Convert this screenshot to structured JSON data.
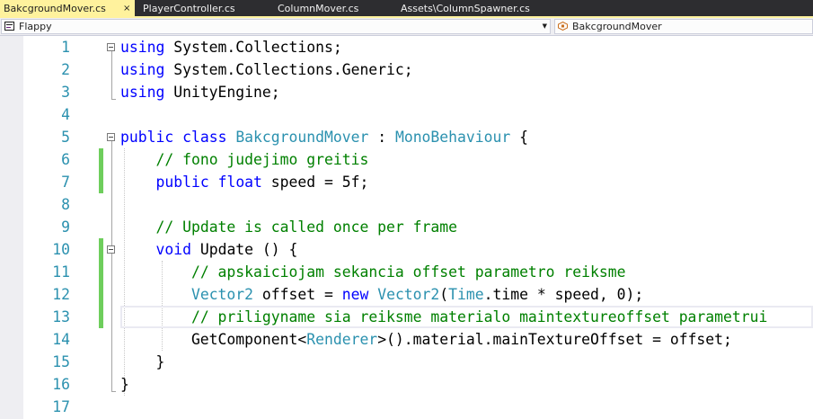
{
  "tabs": [
    {
      "label": "BakcgroundMover.cs",
      "active": true,
      "close_glyph": "×"
    },
    {
      "label": "PlayerController.cs",
      "active": false
    },
    {
      "label": "ColumnMover.cs",
      "active": false
    },
    {
      "label": "Assets\\ColumnSpawner.cs",
      "active": false
    }
  ],
  "navbar": {
    "project_combo": "Flappy",
    "class_combo": "BakcgroundMover",
    "dropdown_glyph": "▼"
  },
  "editor": {
    "line_numbers": [
      "1",
      "2",
      "3",
      "4",
      "5",
      "6",
      "7",
      "8",
      "9",
      "10",
      "11",
      "12",
      "13",
      "14",
      "15",
      "16",
      "17"
    ],
    "lines": [
      [
        {
          "t": "using",
          "c": "kw"
        },
        {
          "t": " System.Collections;",
          "c": "txt"
        }
      ],
      [
        {
          "t": "using",
          "c": "kw"
        },
        {
          "t": " System.Collections.Generic;",
          "c": "txt"
        }
      ],
      [
        {
          "t": "using",
          "c": "kw"
        },
        {
          "t": " UnityEngine;",
          "c": "txt"
        }
      ],
      [],
      [
        {
          "t": "public",
          "c": "kw"
        },
        {
          "t": " ",
          "c": "txt"
        },
        {
          "t": "class",
          "c": "kw"
        },
        {
          "t": " ",
          "c": "txt"
        },
        {
          "t": "BakcgroundMover",
          "c": "ty"
        },
        {
          "t": " : ",
          "c": "txt"
        },
        {
          "t": "MonoBehaviour",
          "c": "ty"
        },
        {
          "t": " {",
          "c": "txt"
        }
      ],
      [
        {
          "t": "    ",
          "c": "txt"
        },
        {
          "t": "// fono judejimo greitis",
          "c": "cm"
        }
      ],
      [
        {
          "t": "    ",
          "c": "txt"
        },
        {
          "t": "public",
          "c": "kw"
        },
        {
          "t": " ",
          "c": "txt"
        },
        {
          "t": "float",
          "c": "kw"
        },
        {
          "t": " speed = 5f;",
          "c": "txt"
        }
      ],
      [],
      [
        {
          "t": "    ",
          "c": "txt"
        },
        {
          "t": "// Update is called once per frame",
          "c": "cm"
        }
      ],
      [
        {
          "t": "    ",
          "c": "txt"
        },
        {
          "t": "void",
          "c": "kw"
        },
        {
          "t": " Update () {",
          "c": "txt"
        }
      ],
      [
        {
          "t": "        ",
          "c": "txt"
        },
        {
          "t": "// apskaiciojam sekancia offset parametro reiksme",
          "c": "cm"
        }
      ],
      [
        {
          "t": "        ",
          "c": "txt"
        },
        {
          "t": "Vector2",
          "c": "ty"
        },
        {
          "t": " offset = ",
          "c": "txt"
        },
        {
          "t": "new",
          "c": "kw"
        },
        {
          "t": " ",
          "c": "txt"
        },
        {
          "t": "Vector2",
          "c": "ty"
        },
        {
          "t": "(",
          "c": "txt"
        },
        {
          "t": "Time",
          "c": "ty"
        },
        {
          "t": ".time * speed, 0);",
          "c": "txt"
        }
      ],
      [
        {
          "t": "        ",
          "c": "txt"
        },
        {
          "t": "// priligyname sia reiksme materialo maintextureoffset parametrui",
          "c": "cm"
        }
      ],
      [
        {
          "t": "        GetComponent<",
          "c": "txt"
        },
        {
          "t": "Renderer",
          "c": "ty"
        },
        {
          "t": ">().material.mainTextureOffset = offset;",
          "c": "txt"
        }
      ],
      [
        {
          "t": "    }",
          "c": "txt"
        }
      ],
      [
        {
          "t": "}",
          "c": "txt"
        }
      ],
      []
    ]
  },
  "colors": {
    "keyword": "#0000ff",
    "type": "#2b91af",
    "comment": "#008000",
    "line_number": "#2b91af",
    "change_marker": "#6ece5c",
    "active_tab": "#fff29d"
  }
}
